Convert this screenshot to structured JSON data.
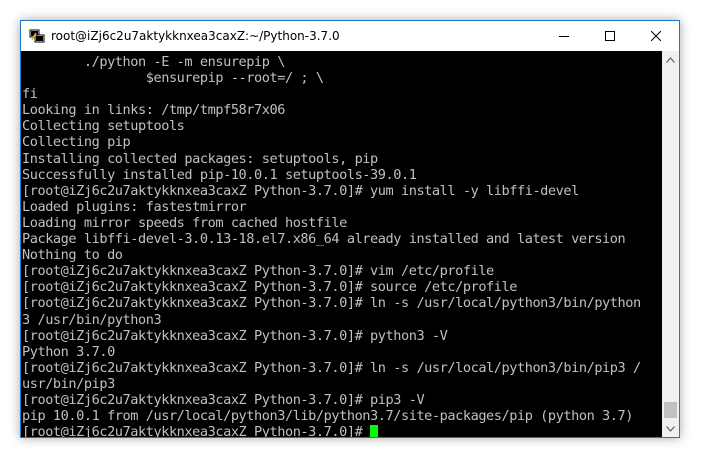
{
  "window": {
    "title": "root@iZj6c2u7aktykknxea3caxZ:~/Python-3.7.0"
  },
  "icons": {
    "app": "putty-icon",
    "minimize": "minimize-icon",
    "maximize": "maximize-icon",
    "close": "close-icon"
  },
  "terminal": {
    "lines": [
      "        ./python -E -m ensurepip \\",
      "                $ensurepip --root=/ ; \\",
      "fi",
      "Looking in links: /tmp/tmpf58r7x06",
      "Collecting setuptools",
      "Collecting pip",
      "Installing collected packages: setuptools, pip",
      "Successfully installed pip-10.0.1 setuptools-39.0.1",
      "[root@iZj6c2u7aktykknxea3caxZ Python-3.7.0]# yum install -y libffi-devel",
      "Loaded plugins: fastestmirror",
      "Loading mirror speeds from cached hostfile",
      "Package libffi-devel-3.0.13-18.el7.x86_64 already installed and latest version",
      "Nothing to do",
      "[root@iZj6c2u7aktykknxea3caxZ Python-3.7.0]# vim /etc/profile",
      "[root@iZj6c2u7aktykknxea3caxZ Python-3.7.0]# source /etc/profile",
      "[root@iZj6c2u7aktykknxea3caxZ Python-3.7.0]# ln -s /usr/local/python3/bin/python",
      "3 /usr/bin/python3",
      "[root@iZj6c2u7aktykknxea3caxZ Python-3.7.0]# python3 -V",
      "Python 3.7.0",
      "[root@iZj6c2u7aktykknxea3caxZ Python-3.7.0]# ln -s /usr/local/python3/bin/pip3 /",
      "usr/bin/pip3",
      "[root@iZj6c2u7aktykknxea3caxZ Python-3.7.0]# pip3 -V",
      "pip 10.0.1 from /usr/local/python3/lib/python3.7/site-packages/pip (python 3.7)"
    ],
    "prompt": "[root@iZj6c2u7aktykknxea3caxZ Python-3.7.0]# ",
    "cursor_color": "#00ff00",
    "text_color": "#c0c0c0",
    "background": "#000000"
  }
}
